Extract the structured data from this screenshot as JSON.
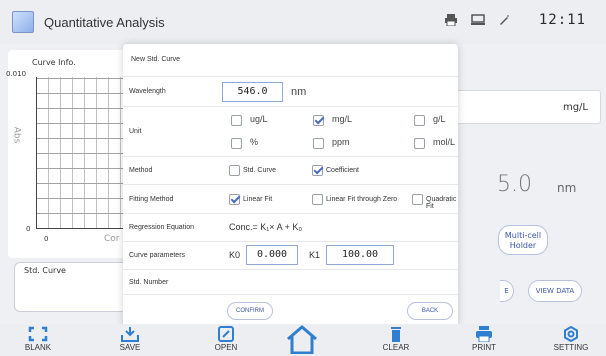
{
  "header": {
    "title": "Quantitative Analysis",
    "time": "12:11"
  },
  "background": {
    "curve_info_title": "Curve Info.",
    "y_axis_top": "0.010",
    "y_axis_zero": "0",
    "x_axis_zero": "0",
    "x_axis_label_partial": "Cor",
    "y_axis_label": "Abs",
    "std_curve_label": "Std. Curve",
    "unit_display": "mg/L",
    "wavelength_value": "5.0",
    "wavelength_unit": "nm",
    "multi_cell_button": "Multi-cell Holder",
    "view_data_button": "VIEW DATA",
    "partial_button_edge": "E"
  },
  "dialog": {
    "title": "New Std. Curve",
    "wavelength": {
      "label": "Wavelength",
      "value": "546.0",
      "unit": "nm"
    },
    "unit": {
      "label": "Unit",
      "options": [
        {
          "label": "ug/L",
          "checked": false
        },
        {
          "label": "mg/L",
          "checked": true
        },
        {
          "label": "g/L",
          "checked": false
        },
        {
          "label": "%",
          "checked": false
        },
        {
          "label": "ppm",
          "checked": false
        },
        {
          "label": "mol/L",
          "checked": false
        }
      ]
    },
    "method": {
      "label": "Method",
      "options": [
        {
          "label": "Std. Curve",
          "checked": false
        },
        {
          "label": "Coefficient",
          "checked": true
        }
      ]
    },
    "fitting": {
      "label": "Fitting Method",
      "options": [
        {
          "label": "Linear Fit",
          "checked": true
        },
        {
          "label": "Linear Fit through Zero",
          "checked": false
        },
        {
          "label": "Quadratic Fit",
          "checked": false
        }
      ]
    },
    "regression": {
      "label": "Regression Equation",
      "equation": "Conc.= K₁× A + K₀"
    },
    "curve_params": {
      "label": "Curve parameters",
      "k0_label": "K0",
      "k0_value": "0.000",
      "k1_label": "K1",
      "k1_value": "100.00"
    },
    "std_number": {
      "label": "Std. Number"
    },
    "confirm_button": "CONFIRM",
    "back_button": "BACK"
  },
  "bottom_bar": {
    "items": [
      {
        "label": "BLANK",
        "icon": "blank-icon"
      },
      {
        "label": "SAVE",
        "icon": "save-icon"
      },
      {
        "label": "OPEN",
        "icon": "open-icon"
      },
      {
        "label": "",
        "icon": "home-icon"
      },
      {
        "label": "CLEAR",
        "icon": "trash-icon"
      },
      {
        "label": "PRINT",
        "icon": "print-icon"
      },
      {
        "label": "SETTING",
        "icon": "settings-icon"
      }
    ]
  },
  "colors": {
    "accent": "#3a56a6",
    "icon_blue": "#2f7fd1"
  }
}
